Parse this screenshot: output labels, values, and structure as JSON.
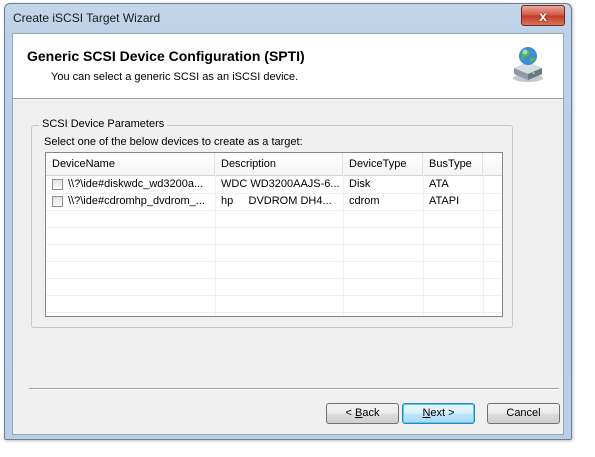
{
  "window": {
    "title": "Create iSCSI Target Wizard",
    "close_glyph": "x"
  },
  "header": {
    "title": "Generic SCSI Device Configuration (SPTI)",
    "subtitle": "You can select a generic SCSI as an iSCSI device.",
    "icon": "network-drive-icon"
  },
  "group": {
    "legend": "SCSI Device Parameters",
    "instruction": "Select one of the below devices to create as a target:"
  },
  "table": {
    "columns": [
      "DeviceName",
      "Description",
      "DeviceType",
      "BusType"
    ],
    "rows": [
      {
        "checked": false,
        "name": "\\\\?\\ide#diskwdc_wd3200a...",
        "description": "WDC WD3200AAJS-6...",
        "type": "Disk",
        "bus": "ATA"
      },
      {
        "checked": false,
        "name": "\\\\?\\ide#cdromhp_dvdrom_...",
        "description": "hp     DVDROM DH4...",
        "type": "cdrom",
        "bus": "ATAPI"
      }
    ]
  },
  "buttons": {
    "back": {
      "prefix": "< ",
      "mnemonic": "B",
      "rest": "ack"
    },
    "next": {
      "mnemonic": "N",
      "rest": "ext >"
    },
    "cancel": "Cancel"
  }
}
